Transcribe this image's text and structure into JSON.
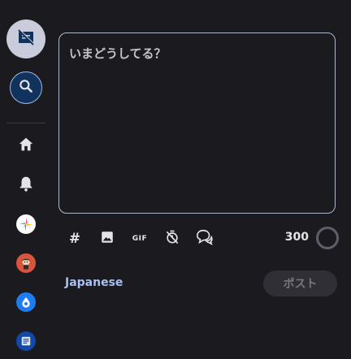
{
  "sidebar": {
    "compose_icon": "compose-off-icon",
    "search_icon": "search-icon",
    "items": [
      {
        "name": "home",
        "icon": "home-icon"
      },
      {
        "name": "notifications",
        "icon": "bell-icon"
      },
      {
        "name": "feed-1",
        "icon": "colorful-star-icon"
      },
      {
        "name": "feed-2",
        "icon": "character-avatar-icon"
      },
      {
        "name": "feed-3",
        "icon": "drop-icon"
      },
      {
        "name": "feed-4",
        "icon": "list-icon"
      }
    ]
  },
  "compose": {
    "placeholder": "いまどうしてる？",
    "value": ""
  },
  "toolbar": {
    "hashtag_icon": "#",
    "image_icon": "image-icon",
    "gif_label": "GIF",
    "timer_icon": "timer-off-icon",
    "quote_icon": "speech-bubbles-icon",
    "char_count": "300"
  },
  "footer": {
    "language": "Japanese",
    "post_label": "ポスト"
  },
  "colors": {
    "background": "#1b1b1f",
    "accent": "#a8c0f2",
    "compose_toggle": "#c9ccdb",
    "search_bg": "#12325e"
  }
}
